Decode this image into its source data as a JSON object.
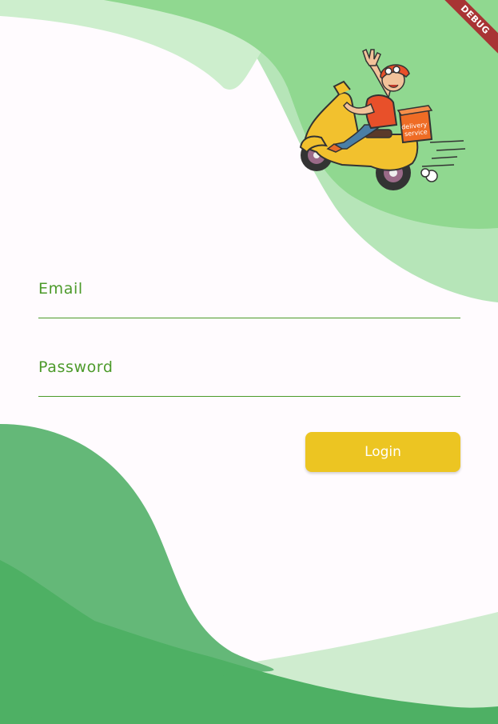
{
  "debug_banner": {
    "label": "DEBUG",
    "color": "#a83434"
  },
  "illustration": {
    "box_text_line1": "delivery",
    "box_text_line2": "service",
    "name": "delivery-scooter-illustration"
  },
  "form": {
    "email": {
      "label": "Email",
      "value": ""
    },
    "password": {
      "label": "Password",
      "value": ""
    }
  },
  "login_button": {
    "label": "Login"
  },
  "colors": {
    "background": "#fffbfe",
    "accent_green": "#4c9a2a",
    "button_yellow": "#ecc522",
    "wave_light": "#b6e5b8",
    "wave_mid": "#90d890",
    "wave_dark": "#4eb064"
  }
}
